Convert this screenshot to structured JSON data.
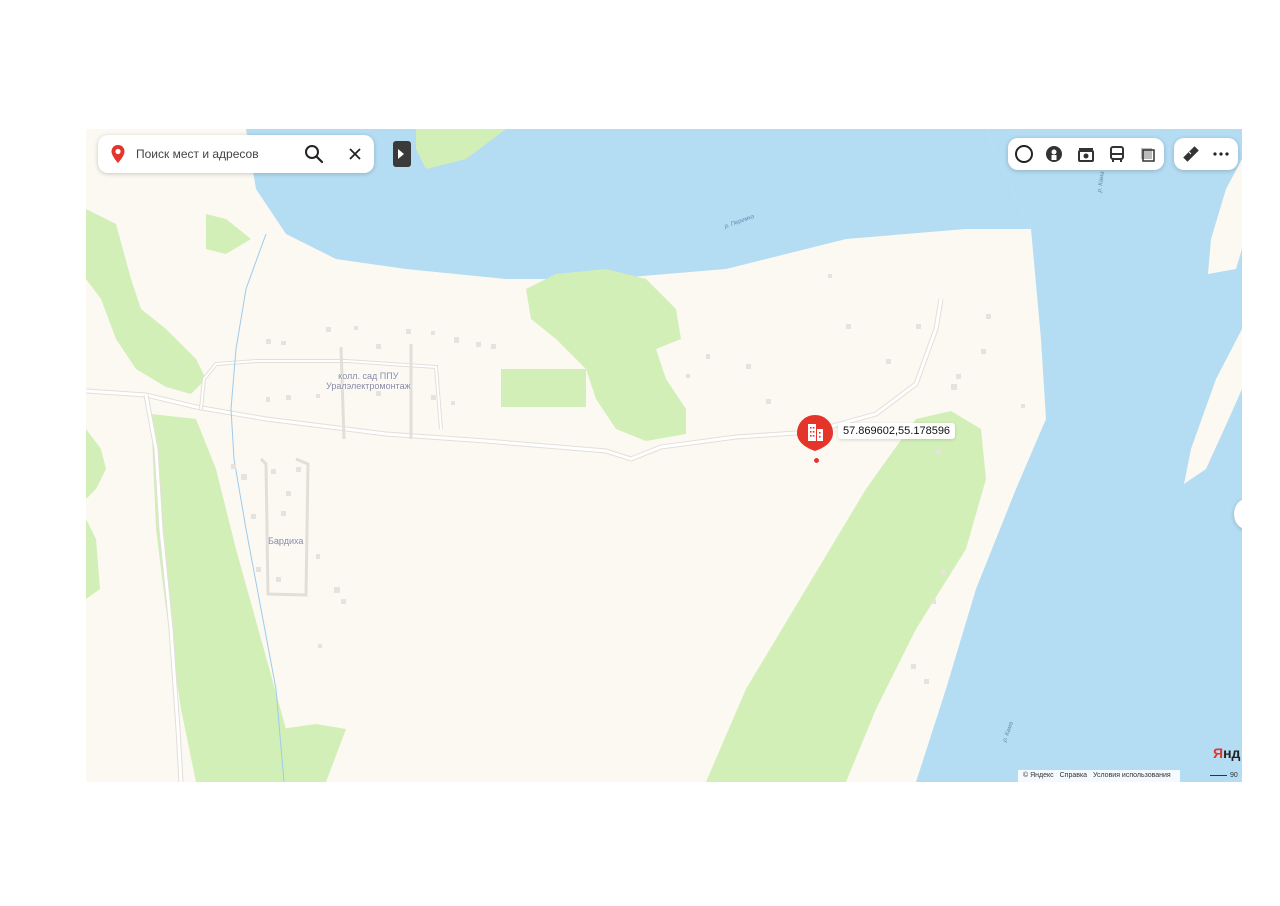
{
  "search": {
    "placeholder": "Поиск мест и адресов",
    "search_icon": "search-icon",
    "clear_icon": "close-icon"
  },
  "toolbar": {
    "icons": [
      "traffic-icon",
      "panorama-icon",
      "photos-icon",
      "transit-icon",
      "layers-icon",
      "ruler-icon",
      "more-icon"
    ]
  },
  "map": {
    "labels": {
      "garden": "колл. сад ППУ\nУралэлектромонтаж",
      "village": "Бардиха",
      "river_top": "р. Перемка",
      "river_kama_top": "р. Кама",
      "river_kama_bottom": "р. Кама"
    },
    "marker": {
      "coordinates": "57.869602,55.178596",
      "icon": "building-marker-icon",
      "color": "#e5352b"
    }
  },
  "brand": {
    "first_letter": "Я",
    "rest": "нд"
  },
  "footer": {
    "attribution": [
      "© Яндекс",
      "Справка",
      "Условия использования"
    ],
    "scale": "90"
  },
  "colors": {
    "water": "#b4dcf3",
    "forest": "#d3efb8",
    "land": "#fbf9f1"
  }
}
